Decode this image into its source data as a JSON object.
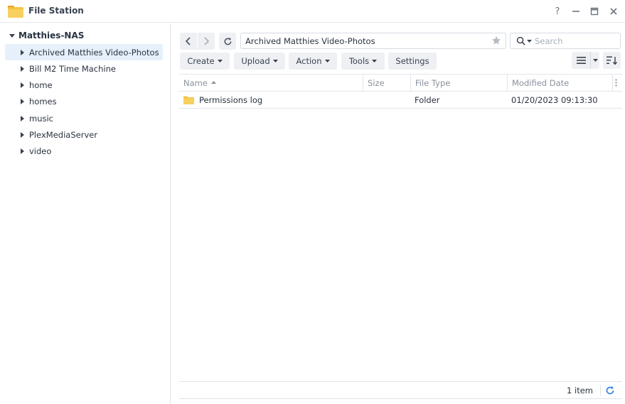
{
  "window": {
    "title": "File Station",
    "help": "?",
    "minimize": "—",
    "maximize": "□",
    "close": "✕"
  },
  "sidebar": {
    "root": "Matthies-NAS",
    "items": [
      {
        "label": "Archived Matthies Video-Photos",
        "selected": true
      },
      {
        "label": "Bill M2 Time Machine"
      },
      {
        "label": "home"
      },
      {
        "label": "homes"
      },
      {
        "label": "music"
      },
      {
        "label": "PlexMediaServer"
      },
      {
        "label": "video"
      }
    ]
  },
  "toolbar": {
    "path": "Archived Matthies Video-Photos",
    "search_placeholder": "Search",
    "create": "Create",
    "upload": "Upload",
    "action": "Action",
    "tools": "Tools",
    "settings": "Settings"
  },
  "table": {
    "columns": [
      "Name",
      "Size",
      "File Type",
      "Modified Date"
    ],
    "rows": [
      {
        "name": "Permissions log",
        "size": "",
        "type": "Folder",
        "modified": "01/20/2023 09:13:30"
      }
    ]
  },
  "footer": {
    "count": "1 item"
  },
  "colors": {
    "accent": "#2c7be5",
    "selected_bg": "#e6f0fb",
    "folder": "#f5c342"
  }
}
